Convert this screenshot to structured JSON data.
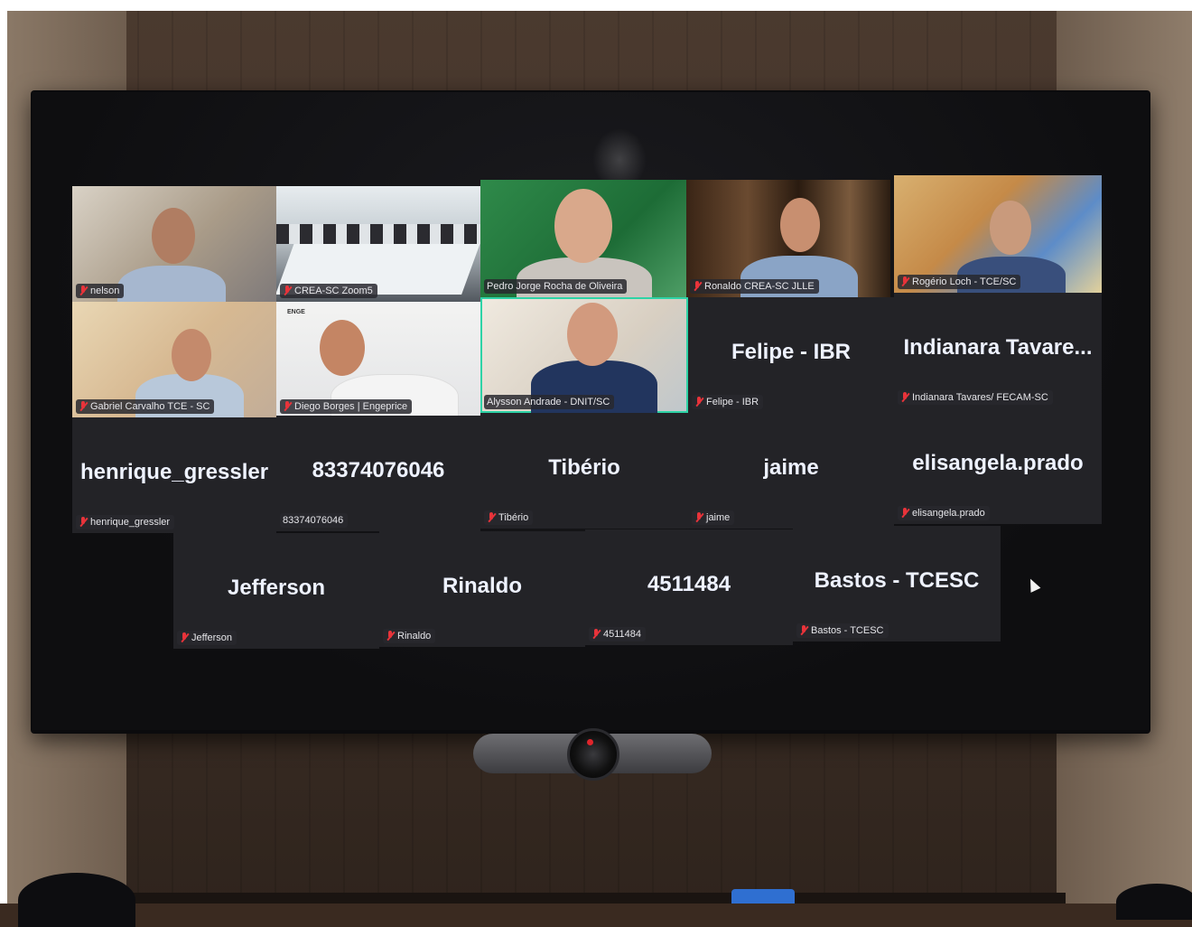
{
  "meeting": {
    "video_tiles": [
      {
        "label": "nelson"
      },
      {
        "label": "CREA-SC Zoom5"
      },
      {
        "label": "Pedro Jorge Rocha de Oliveira"
      },
      {
        "label": "Ronaldo CREA-SC JLLE"
      },
      {
        "label": "Rogério Loch - TCE/SC"
      },
      {
        "label": "Gabriel Carvalho TCE - SC"
      },
      {
        "label": "Diego Borges | Engeprice"
      },
      {
        "label": "Alysson Andrade - DNIT/SC"
      }
    ],
    "name_tiles": [
      {
        "display": "Felipe - IBR",
        "label": "Felipe - IBR"
      },
      {
        "display": "Indianara Tavare...",
        "label": "Indianara Tavares/ FECAM-SC"
      },
      {
        "display": "henrique_gressler",
        "label": "henrique_gressler"
      },
      {
        "display": "83374076046",
        "label": "83374076046"
      },
      {
        "display": "Tibério",
        "label": "Tibério"
      },
      {
        "display": "jaime",
        "label": "jaime"
      },
      {
        "display": "elisangela.prado",
        "label": "elisangela.prado"
      },
      {
        "display": "Jefferson",
        "label": "Jefferson"
      },
      {
        "display": "Rinaldo",
        "label": "Rinaldo"
      },
      {
        "display": "4511484",
        "label": "4511484"
      },
      {
        "display": "Bastos - TCESC",
        "label": "Bastos - TCESC"
      }
    ],
    "slide_tag": "ENGE",
    "active_speaker_color": "#2ed3a6",
    "muted_icon": "muted-mic-icon",
    "muted_icon_color": "#e8333a"
  }
}
